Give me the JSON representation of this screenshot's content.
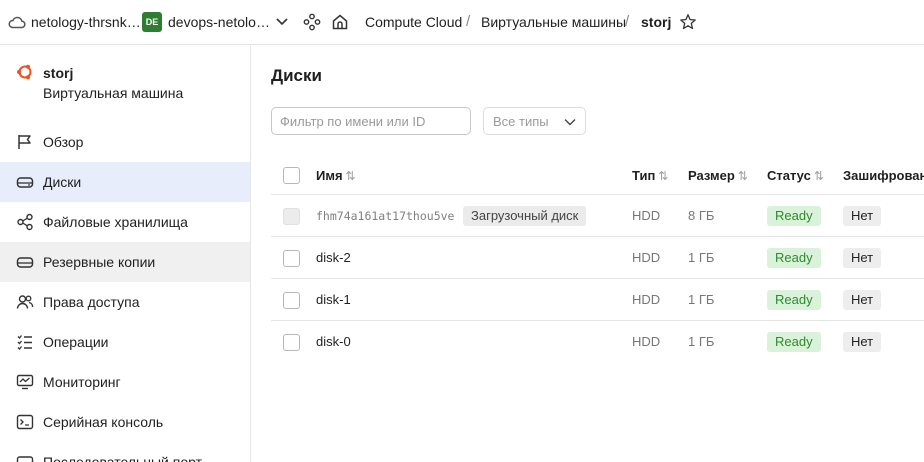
{
  "topbar": {
    "org": "netology-thrsnk…",
    "folder_badge": "DE",
    "folder": "devops-netolo…",
    "breadcrumbs": [
      "Compute Cloud",
      "Виртуальные машины",
      "storj"
    ],
    "separator": "/"
  },
  "sidebar": {
    "vm_name": "storj",
    "vm_subtitle": "Виртуальная машина",
    "items": [
      {
        "label": "Обзор",
        "icon": "flag-icon"
      },
      {
        "label": "Диски",
        "icon": "disk-icon"
      },
      {
        "label": "Файловые хранилища",
        "icon": "share-icon"
      },
      {
        "label": "Резервные копии",
        "icon": "backup-icon"
      },
      {
        "label": "Права доступа",
        "icon": "users-icon"
      },
      {
        "label": "Операции",
        "icon": "list-icon"
      },
      {
        "label": "Мониторинг",
        "icon": "monitor-icon"
      },
      {
        "label": "Серийная консоль",
        "icon": "terminal-icon"
      },
      {
        "label": "Последовательный порт",
        "icon": "port-icon"
      }
    ]
  },
  "main": {
    "title": "Диски",
    "filter_placeholder": "Фильтр по имени или ID",
    "type_filter": "Все типы",
    "columns": {
      "name": "Имя",
      "type": "Тип",
      "size": "Размер",
      "status": "Статус",
      "encrypted": "Зашифрован"
    },
    "rows": [
      {
        "name": "fhm74a161at17thou5ve",
        "tag": "Загрузочный диск",
        "type": "HDD",
        "size": "8 ГБ",
        "status": "Ready",
        "encrypted": "Нет"
      },
      {
        "name": "disk-2",
        "type": "HDD",
        "size": "1 ГБ",
        "status": "Ready",
        "encrypted": "Нет"
      },
      {
        "name": "disk-1",
        "type": "HDD",
        "size": "1 ГБ",
        "status": "Ready",
        "encrypted": "Нет"
      },
      {
        "name": "disk-0",
        "type": "HDD",
        "size": "1 ГБ",
        "status": "Ready",
        "encrypted": "Нет"
      }
    ]
  },
  "colors": {
    "accent_active": "#e8edfb",
    "status_ready_bg": "#daf1da",
    "status_ready_fg": "#2e8b2e",
    "folder_badge": "#2e7d32"
  }
}
